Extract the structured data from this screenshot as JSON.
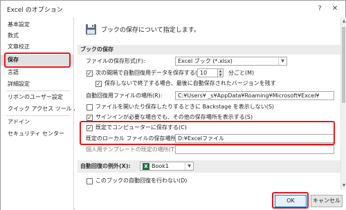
{
  "window": {
    "title": "Excel のオプション",
    "help_icon": "?",
    "close_icon": "✕"
  },
  "sidebar": {
    "items": [
      {
        "label": "基本設定"
      },
      {
        "label": "数式"
      },
      {
        "label": "文章校正"
      },
      {
        "label": "保存",
        "selected": true
      },
      {
        "label": "言語"
      },
      {
        "label": "詳細設定"
      },
      {
        "label": "リボンのユーザー設定"
      },
      {
        "label": "クイック アクセス ツール バー"
      },
      {
        "label": "アドイン"
      },
      {
        "label": "セキュリティ センター"
      }
    ]
  },
  "header": {
    "text": "ブックの保存について指定します。",
    "icon": "save-disk-icon"
  },
  "section_save": {
    "title": "ブックの保存",
    "format_label": "ファイルの保存形式(F):",
    "format_value": "Excel ブック (*.xlsx)",
    "autorecover_label": "次の間隔で自動回復用データを保存する(A):",
    "autorecover_checked": true,
    "autorecover_minutes": "10",
    "autorecover_unit": "分ごと(M)",
    "keep_last_label": "保存しないで終了する場合、最後に自動保存されたバージョンを残す",
    "keep_last_checked": true,
    "autorecover_location_label": "自動回復用ファイルの場所(R):",
    "autorecover_location_value": "C:¥Users¥      _s¥AppData¥Roaming¥Microsoft¥Excel¥",
    "backstage_label": "ファイルを開いたり保存したりするときに Backstage を表示しない(S)",
    "backstage_checked": false,
    "signin_label": "サインインが必要な場合でも、その他の保存場所を表示する(S)",
    "signin_checked": true,
    "save_to_computer_label": "既定でコンピューターに保存する(C)",
    "save_to_computer_checked": true,
    "default_local_label": "既定のローカル ファイルの保存場所(I):",
    "default_local_value": "D:¥Excelファイル",
    "templates_label": "個人用テンプレートの既定の場所(T):",
    "templates_value": ""
  },
  "section_autorecover_except": {
    "label": "自動回復の例外(X):",
    "book_value": "Book1",
    "disable_label": "このブックの自動回復を行わない(D)",
    "disable_checked": false
  },
  "footer": {
    "ok_label": "OK",
    "cancel_label": "キャンセル"
  },
  "colors": {
    "highlight_red": "#e8141a",
    "selected_nav_bg": "#e1e1e1",
    "section_bg": "#ececec",
    "excel_green": "#1e7145"
  }
}
